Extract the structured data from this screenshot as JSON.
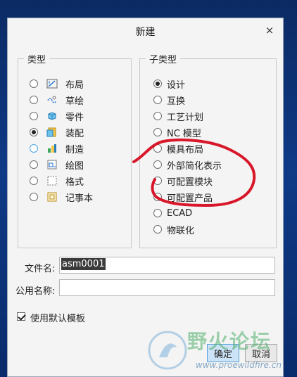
{
  "dialog": {
    "title": "新建",
    "close_glyph": "×"
  },
  "type_group": {
    "legend": "类型",
    "items": [
      {
        "label": "布局",
        "icon": "layout-icon",
        "selected": false
      },
      {
        "label": "草绘",
        "icon": "sketch-icon",
        "selected": false
      },
      {
        "label": "零件",
        "icon": "part-icon",
        "selected": false
      },
      {
        "label": "装配",
        "icon": "assembly-icon",
        "selected": true
      },
      {
        "label": "制造",
        "icon": "manufacturing-icon",
        "selected": false
      },
      {
        "label": "绘图",
        "icon": "drawing-icon",
        "selected": false
      },
      {
        "label": "格式",
        "icon": "format-icon",
        "selected": false
      },
      {
        "label": "记事本",
        "icon": "notebook-icon",
        "selected": false
      }
    ]
  },
  "subtype_group": {
    "legend": "子类型",
    "items": [
      {
        "label": "设计",
        "selected": true
      },
      {
        "label": "互换",
        "selected": false
      },
      {
        "label": "工艺计划",
        "selected": false
      },
      {
        "label": "NC 模型",
        "selected": false
      },
      {
        "label": "模具布局",
        "selected": false
      },
      {
        "label": "外部简化表示",
        "selected": false
      },
      {
        "label": "可配置模块",
        "selected": false
      },
      {
        "label": "可配置产品",
        "selected": false
      },
      {
        "label": "ECAD",
        "selected": false
      },
      {
        "label": "物联化",
        "selected": false
      }
    ]
  },
  "form": {
    "filename_label": "文件名:",
    "filename_value": "asm0001",
    "common_name_label": "公用名称:",
    "common_name_value": "",
    "use_default_template_label": "使用默认模板",
    "use_default_template_checked": true
  },
  "buttons": {
    "ok_label": "确定",
    "cancel_label": "取消"
  },
  "watermark": {
    "text": "野火论坛",
    "url": "www.proewildfire.cn"
  },
  "colors": {
    "annotation_red": "#d8182a",
    "accent_blue": "#4aa3e6",
    "background_blue": "#0e3a86"
  }
}
